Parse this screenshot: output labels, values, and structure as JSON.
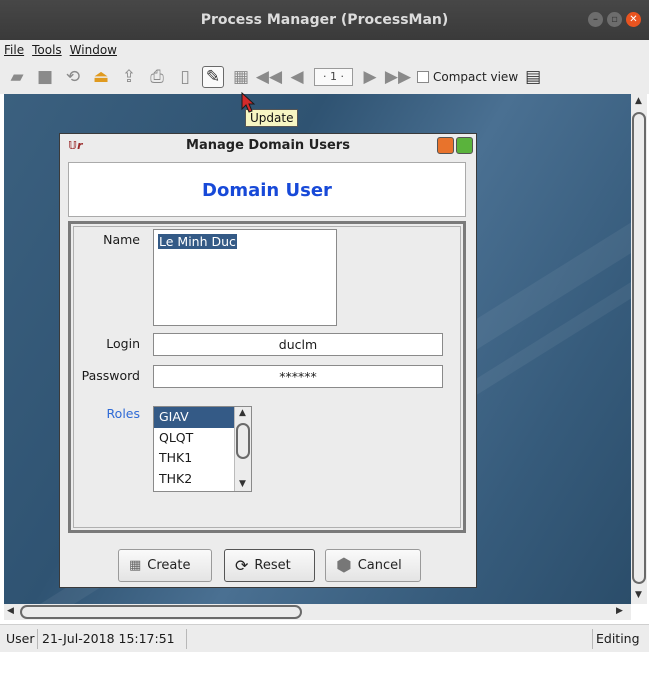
{
  "window": {
    "title": "Process Manager (ProcessMan)"
  },
  "menu": {
    "file": "File",
    "tools": "Tools",
    "window": "Window"
  },
  "toolbar": {
    "page_indicator": "· 1 ·",
    "compact_view_label": "Compact view",
    "compact_view_checked": false,
    "tooltip": "Update"
  },
  "dialog": {
    "title": "Manage Domain Users",
    "heading": "Domain User",
    "name_label": "Name",
    "name_value": "Le Minh Duc",
    "login_label": "Login",
    "login_value": "duclm",
    "password_label": "Password",
    "password_value": "******",
    "roles_label": "Roles",
    "roles": [
      "GIAV",
      "QLQT",
      "THK1",
      "THK2"
    ],
    "selected_role": "GIAV",
    "create_label": "Create",
    "reset_label": "Reset",
    "cancel_label": "Cancel"
  },
  "status": {
    "user": "User",
    "datetime": "21-Jul-2018 15:17:51",
    "mode": "Editing"
  },
  "colors": {
    "heading_blue": "#1749d8",
    "selection": "#345a86",
    "close_button": "#e95420",
    "dialog_button": "#e8732c",
    "desktop": "#3b607f"
  }
}
